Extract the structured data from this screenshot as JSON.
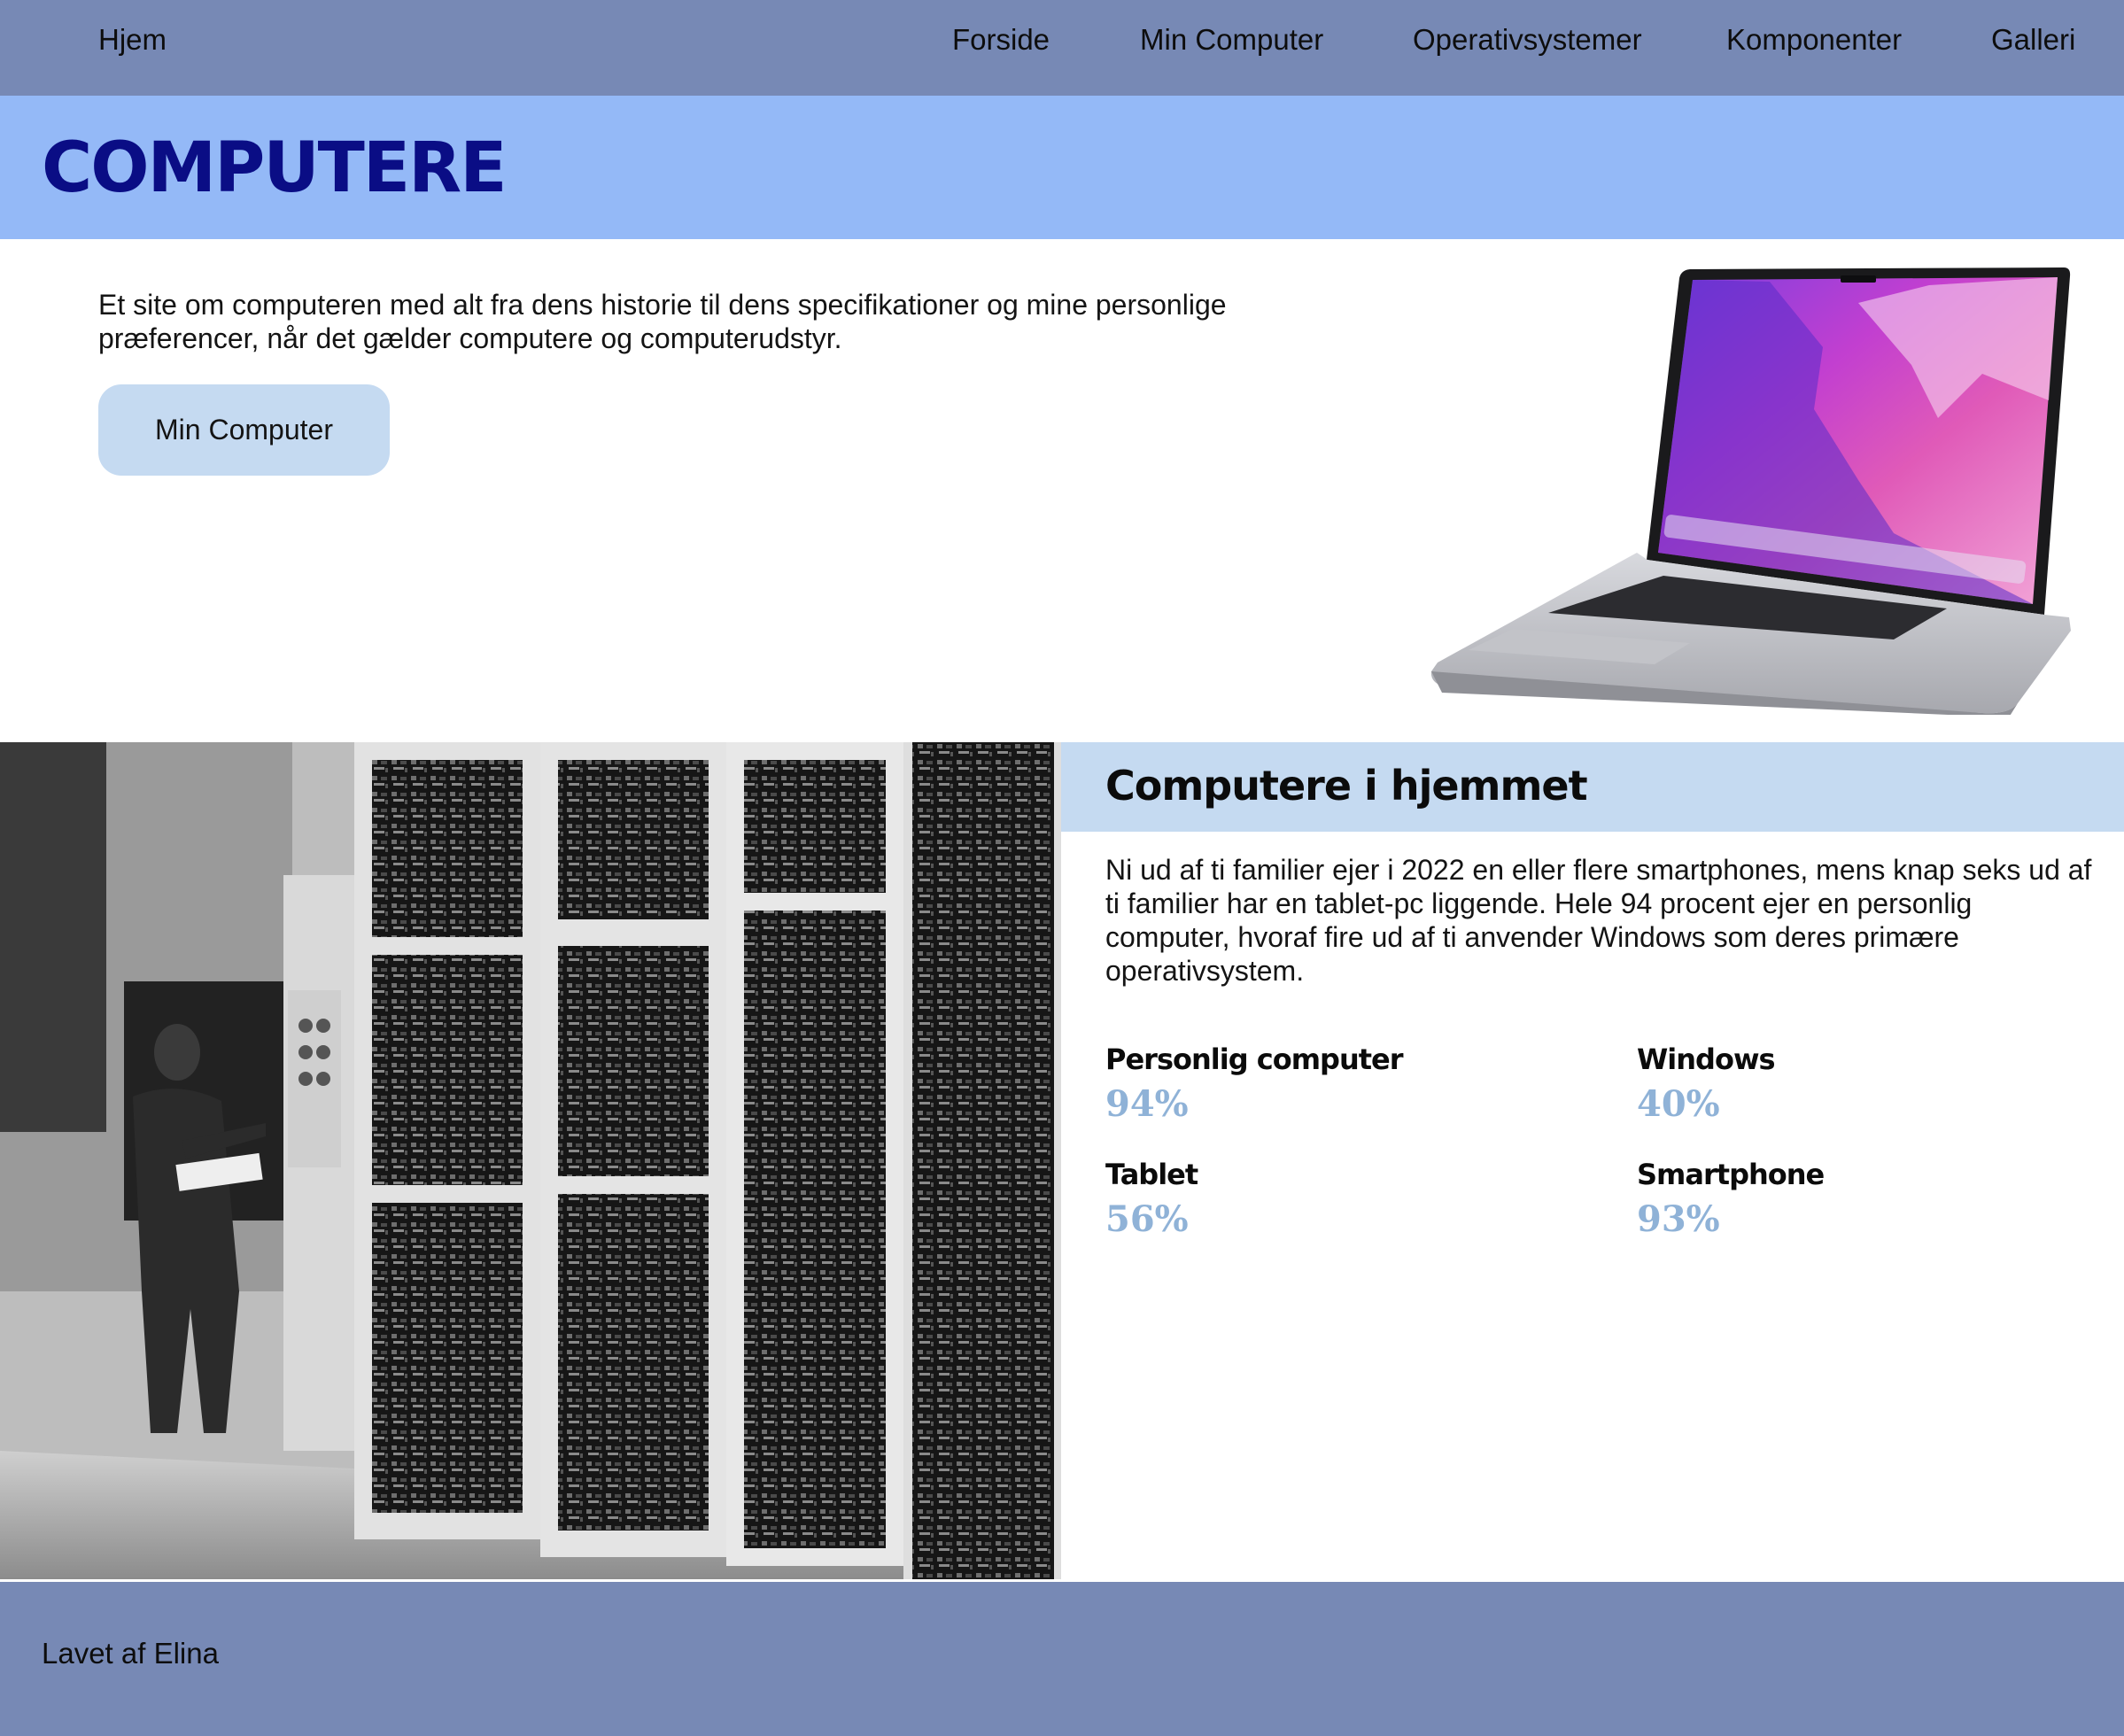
{
  "nav": {
    "home": "Hjem",
    "links": [
      "Forside",
      "Min Computer",
      "Operativsystemer",
      "Komponenter",
      "Galleri"
    ]
  },
  "hero": {
    "title": "COMPUTERE",
    "intro": "Et site om computeren med alt fra dens historie til dens specifikationer og mine personlige præferencer, når det gælder computere og computerudstyr.",
    "button_label": "Min Computer"
  },
  "stats_section": {
    "heading": "Computere i hjemmet",
    "body": "Ni ud af ti familier ejer i 2022 en eller flere smartphones, mens knap seks ud af ti familier har en tablet-pc liggende. Hele 94 procent ejer en personlig computer, hvoraf fire ud af ti anvender Windows som deres primære operativsystem.",
    "stats": [
      {
        "label": "Personlig computer",
        "value": "94%"
      },
      {
        "label": "Windows",
        "value": "40%"
      },
      {
        "label": "Tablet",
        "value": "56%"
      },
      {
        "label": "Smartphone",
        "value": "93%"
      }
    ]
  },
  "footer": {
    "credit": "Lavet af Elina"
  },
  "colors": {
    "nav_bg": "#7789b5",
    "title_bar_bg": "#94b9f7",
    "title_text": "#0a0d85",
    "button_bg": "#c5daf1",
    "stat_value": "#8fb2d7"
  }
}
